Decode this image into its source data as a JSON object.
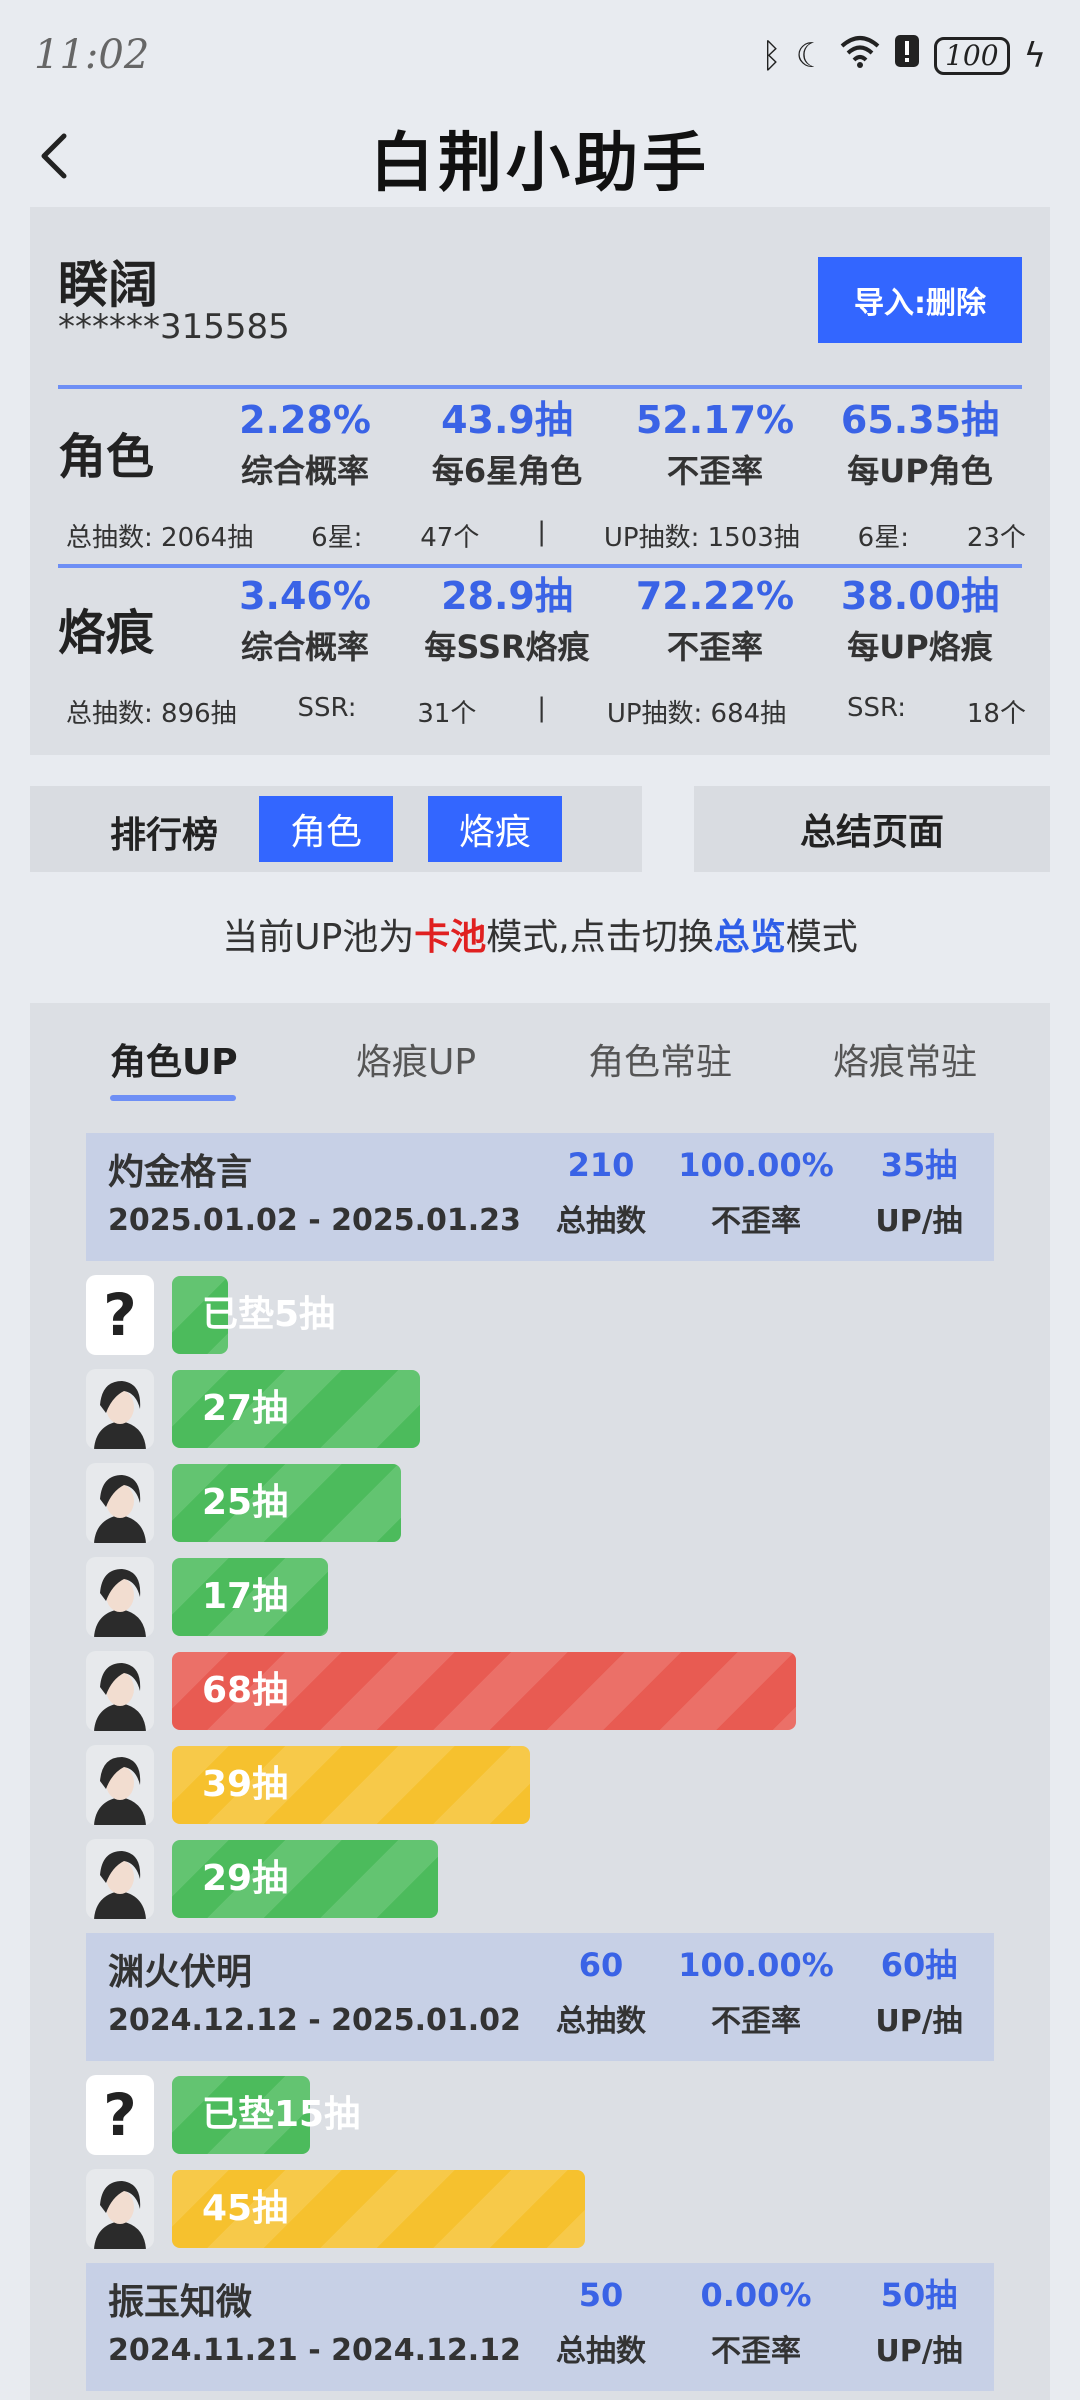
{
  "status": {
    "time": "11:02",
    "battery": "100"
  },
  "header": {
    "title": "白荆小助手"
  },
  "account": {
    "name": "睽阔",
    "id": "******315585",
    "import_label": "导入:删除"
  },
  "character": {
    "label": "角色",
    "stats": [
      {
        "value": "2.28%",
        "label": "综合概率"
      },
      {
        "value": "43.9抽",
        "label": "每6星角色"
      },
      {
        "value": "52.17%",
        "label": "不歪率"
      },
      {
        "value": "65.35抽",
        "label": "每UP角色"
      }
    ],
    "summary": [
      "总抽数: 2064抽",
      "6星:",
      "47个",
      "|",
      "UP抽数: 1503抽",
      "6星:",
      "23个"
    ]
  },
  "imprint": {
    "label": "烙痕",
    "stats": [
      {
        "value": "3.46%",
        "label": "综合概率"
      },
      {
        "value": "28.9抽",
        "label": "每SSR烙痕"
      },
      {
        "value": "72.22%",
        "label": "不歪率"
      },
      {
        "value": "38.00抽",
        "label": "每UP烙痕"
      }
    ],
    "summary": [
      "总抽数: 896抽",
      "SSR:",
      "31个",
      "|",
      "UP抽数: 684抽",
      "SSR:",
      "18个"
    ]
  },
  "toolbar": {
    "rank_label": "排行榜",
    "rank_tab_character": "角色",
    "rank_tab_imprint": "烙痕",
    "summary_label": "总结页面"
  },
  "mode": {
    "prefix": "当前UP池为",
    "current": "卡池",
    "mid": "模式,点击切换",
    "alt": "总览",
    "suffix": "模式"
  },
  "tabs": [
    "角色UP",
    "烙痕UP",
    "角色常驻",
    "烙痕常驻"
  ],
  "pools": [
    {
      "name": "灼金格言",
      "dates": "2025.01.02 - 2025.01.23",
      "total": "210",
      "rate": "100.00%",
      "per_up": "35抽",
      "col_labels": [
        "总抽数",
        "不歪率",
        "UP/抽"
      ],
      "pulls": [
        {
          "label": "已垫5抽",
          "value": 5,
          "color": "green",
          "unknown": true
        },
        {
          "label": "27抽",
          "value": 27,
          "color": "green"
        },
        {
          "label": "25抽",
          "value": 25,
          "color": "green"
        },
        {
          "label": "17抽",
          "value": 17,
          "color": "green"
        },
        {
          "label": "68抽",
          "value": 68,
          "color": "red"
        },
        {
          "label": "39抽",
          "value": 39,
          "color": "yellow"
        },
        {
          "label": "29抽",
          "value": 29,
          "color": "green"
        }
      ]
    },
    {
      "name": "渊火伏明",
      "dates": "2024.12.12 - 2025.01.02",
      "total": "60",
      "rate": "100.00%",
      "per_up": "60抽",
      "col_labels": [
        "总抽数",
        "不歪率",
        "UP/抽"
      ],
      "pulls": [
        {
          "label": "已垫15抽",
          "value": 15,
          "color": "green",
          "unknown": true
        },
        {
          "label": "45抽",
          "value": 45,
          "color": "yellow"
        }
      ]
    },
    {
      "name": "振玉知微",
      "dates": "2024.11.21 - 2024.12.12",
      "total": "50",
      "rate": "0.00%",
      "per_up": "50抽",
      "col_labels": [
        "总抽数",
        "不歪率",
        "UP/抽"
      ],
      "pulls": []
    }
  ],
  "colors": {
    "accent": "#3366ff",
    "green": "#4cbb5c",
    "red": "#e85b52",
    "yellow": "#f6c12e"
  }
}
